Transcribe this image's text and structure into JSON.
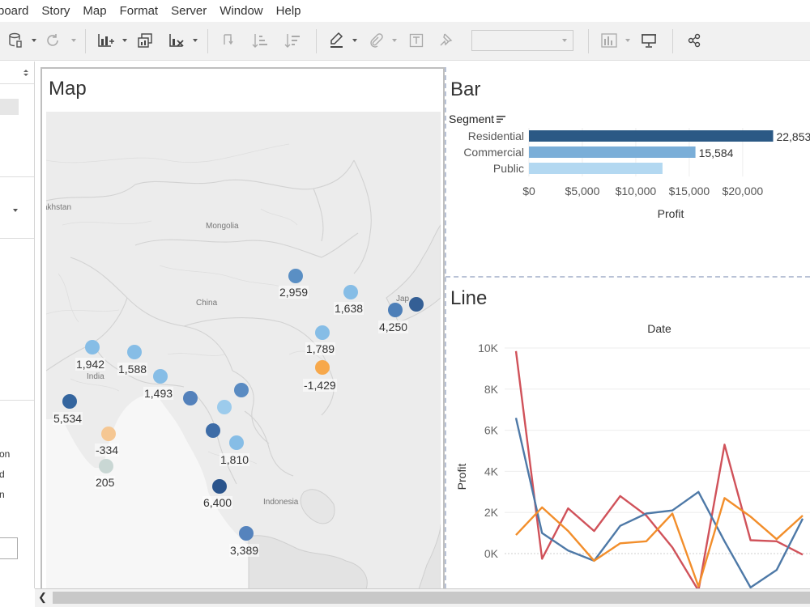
{
  "menu": [
    "board",
    "Story",
    "Map",
    "Format",
    "Server",
    "Window",
    "Help"
  ],
  "left_panel": {
    "truncated_labels": [
      "on",
      "d",
      "n"
    ]
  },
  "map": {
    "title": "Map",
    "place_labels": [
      "akhstan",
      "Mongolia",
      "China",
      "India",
      "Indonesia",
      "Jap"
    ],
    "points": [
      {
        "label": "2,959",
        "value": 2959,
        "color": "#5a8fc4"
      },
      {
        "label": "1,638",
        "value": 1638,
        "color": "#86bde6"
      },
      {
        "label": "4,250",
        "value": 4250,
        "color": "#4d7fb8"
      },
      {
        "label": "",
        "value": 5100,
        "color": "#345f95"
      },
      {
        "label": "1,789",
        "value": 1789,
        "color": "#86bde6"
      },
      {
        "label": "-1,429",
        "value": -1429,
        "color": "#f7a84b"
      },
      {
        "label": "1,942",
        "value": 1942,
        "color": "#86bde6"
      },
      {
        "label": "1,588",
        "value": 1588,
        "color": "#86bde6"
      },
      {
        "label": "1,493",
        "value": 1493,
        "color": "#86bde6"
      },
      {
        "label": "",
        "value": 3200,
        "color": "#5381bb"
      },
      {
        "label": "",
        "value": 3000,
        "color": "#5a8bc2"
      },
      {
        "label": "",
        "value": 1500,
        "color": "#9ccbec"
      },
      {
        "label": "5,534",
        "value": 5534,
        "color": "#34659e"
      },
      {
        "label": "",
        "value": 4800,
        "color": "#3d6ca7"
      },
      {
        "label": "1,810",
        "value": 1810,
        "color": "#86bde6"
      },
      {
        "label": "-334",
        "value": -334,
        "color": "#f5c793"
      },
      {
        "label": "205",
        "value": 205,
        "color": "#c9d7d4"
      },
      {
        "label": "6,400",
        "value": 6400,
        "color": "#2a548c"
      },
      {
        "label": "3,389",
        "value": 3389,
        "color": "#5583bd"
      }
    ]
  },
  "bar": {
    "title": "Bar",
    "segment_label": "Segment",
    "chart_data": {
      "type": "bar",
      "orientation": "horizontal",
      "categories": [
        "Residential",
        "Commercial",
        "Public"
      ],
      "values": [
        22853,
        15584,
        12500
      ],
      "value_labels": [
        "22,853",
        "15,584",
        ""
      ],
      "colors": [
        "#2b5985",
        "#7aaed8",
        "#b3d8f1"
      ],
      "xlabel": "Profit",
      "xlim": [
        0,
        26000
      ],
      "xticks": [
        0,
        5000,
        10000,
        15000,
        20000
      ],
      "xtick_labels": [
        "$0",
        "$5,000",
        "$10,000",
        "$15,000",
        "$20,000"
      ],
      "grid": true
    }
  },
  "line": {
    "title": "Line",
    "chart_data": {
      "type": "line",
      "xlabel": "Date",
      "ylabel": "Profit",
      "ylim": [
        -1500,
        10800
      ],
      "yticks": [
        0,
        2000,
        4000,
        6000,
        8000,
        10000
      ],
      "ytick_labels": [
        "0K",
        "2K",
        "4K",
        "6K",
        "8K",
        "10K"
      ],
      "x_points": 12,
      "series": [
        {
          "color": "#d0525a",
          "values": [
            9850,
            -250,
            2200,
            1100,
            2800,
            1850,
            300,
            -1800,
            5300,
            650,
            600,
            -50
          ]
        },
        {
          "color": "#4e79a7",
          "values": [
            6600,
            1000,
            150,
            -350,
            1350,
            1950,
            2100,
            3000,
            600,
            -1650,
            -800,
            1700
          ]
        },
        {
          "color": "#f28e2b",
          "values": [
            900,
            2250,
            1100,
            -350,
            500,
            600,
            1950,
            -1600,
            2700,
            1800,
            700,
            1850
          ]
        }
      ]
    }
  }
}
